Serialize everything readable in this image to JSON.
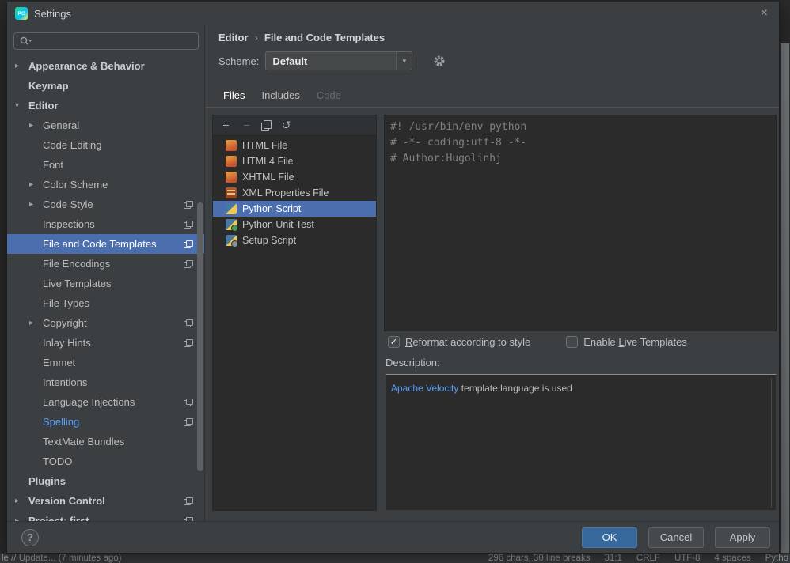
{
  "window": {
    "title": "Settings",
    "logo_text": "PC",
    "close_glyph": "×"
  },
  "ide_behind": {
    "status_left": "le // Update... (7 minutes ago)",
    "status_right": [
      "296 chars, 30 line breaks",
      "31:1",
      "CRLF",
      "UTF-8",
      "4 spaces",
      "Pytho"
    ]
  },
  "sidebar": {
    "search_value": "",
    "items": [
      {
        "label": "Appearance & Behavior",
        "level": 0,
        "bold": true,
        "chevron": "collapsed"
      },
      {
        "label": "Keymap",
        "level": 0,
        "bold": true
      },
      {
        "label": "Editor",
        "level": 0,
        "bold": true,
        "chevron": "expanded"
      },
      {
        "label": "General",
        "level": 1,
        "chevron": "collapsed"
      },
      {
        "label": "Code Editing",
        "level": 1
      },
      {
        "label": "Font",
        "level": 1
      },
      {
        "label": "Color Scheme",
        "level": 1,
        "chevron": "collapsed"
      },
      {
        "label": "Code Style",
        "level": 1,
        "chevron": "collapsed",
        "badge": true
      },
      {
        "label": "Inspections",
        "level": 1,
        "badge": true
      },
      {
        "label": "File and Code Templates",
        "level": 1,
        "badge": true,
        "selected": true
      },
      {
        "label": "File Encodings",
        "level": 1,
        "badge": true
      },
      {
        "label": "Live Templates",
        "level": 1
      },
      {
        "label": "File Types",
        "level": 1
      },
      {
        "label": "Copyright",
        "level": 1,
        "chevron": "collapsed",
        "badge": true
      },
      {
        "label": "Inlay Hints",
        "level": 1,
        "badge": true
      },
      {
        "label": "Emmet",
        "level": 1
      },
      {
        "label": "Intentions",
        "level": 1
      },
      {
        "label": "Language Injections",
        "level": 1,
        "badge": true
      },
      {
        "label": "Spelling",
        "level": 1,
        "badge": true,
        "accent": true
      },
      {
        "label": "TextMate Bundles",
        "level": 1
      },
      {
        "label": "TODO",
        "level": 1
      },
      {
        "label": "Plugins",
        "level": 0,
        "bold": true
      },
      {
        "label": "Version Control",
        "level": 0,
        "bold": true,
        "chevron": "collapsed",
        "badge": true
      },
      {
        "label": "Project: first",
        "level": 0,
        "bold": true,
        "chevron": "collapsed",
        "badge": true
      }
    ]
  },
  "header": {
    "breadcrumb": [
      "Editor",
      "File and Code Templates"
    ],
    "separator": "›",
    "scheme_label": "Scheme:",
    "scheme_value": "Default"
  },
  "tabs": [
    {
      "label": "Files",
      "state": "active"
    },
    {
      "label": "Includes",
      "state": "normal"
    },
    {
      "label": "Code",
      "state": "disabled"
    }
  ],
  "templates": {
    "toolbar": {
      "add_icon": "+",
      "remove_icon": "−",
      "revert_icon": "↺"
    },
    "items": [
      {
        "label": "HTML File",
        "icon": "html"
      },
      {
        "label": "HTML4 File",
        "icon": "html"
      },
      {
        "label": "XHTML File",
        "icon": "html"
      },
      {
        "label": "XML Properties File",
        "icon": "xml"
      },
      {
        "label": "Python Script",
        "icon": "python",
        "selected": true
      },
      {
        "label": "Python Unit Test",
        "icon": "pytest"
      },
      {
        "label": "Setup Script",
        "icon": "pysetup"
      }
    ]
  },
  "editor": {
    "code_lines": [
      "#! /usr/bin/env python",
      "# -*- coding:utf-8 -*-",
      "# Author:Hugolinhj"
    ]
  },
  "options": {
    "reformat": {
      "pre": "",
      "key": "R",
      "post": "eformat according to style",
      "checked": true
    },
    "live_templates": {
      "pre": "Enable ",
      "key": "L",
      "post": "ive Templates",
      "checked": false
    }
  },
  "description": {
    "label": "Description:",
    "link_text": "Apache Velocity",
    "rest_text": " template language is used"
  },
  "footer": {
    "help": "?",
    "ok": "OK",
    "cancel": "Cancel",
    "apply": "Apply"
  },
  "icons": {
    "check": "✓",
    "combo_arrow": "▼"
  },
  "colors": {
    "selection": "#4b6eaf",
    "link": "#589df6",
    "ok_button": "#36689b"
  }
}
